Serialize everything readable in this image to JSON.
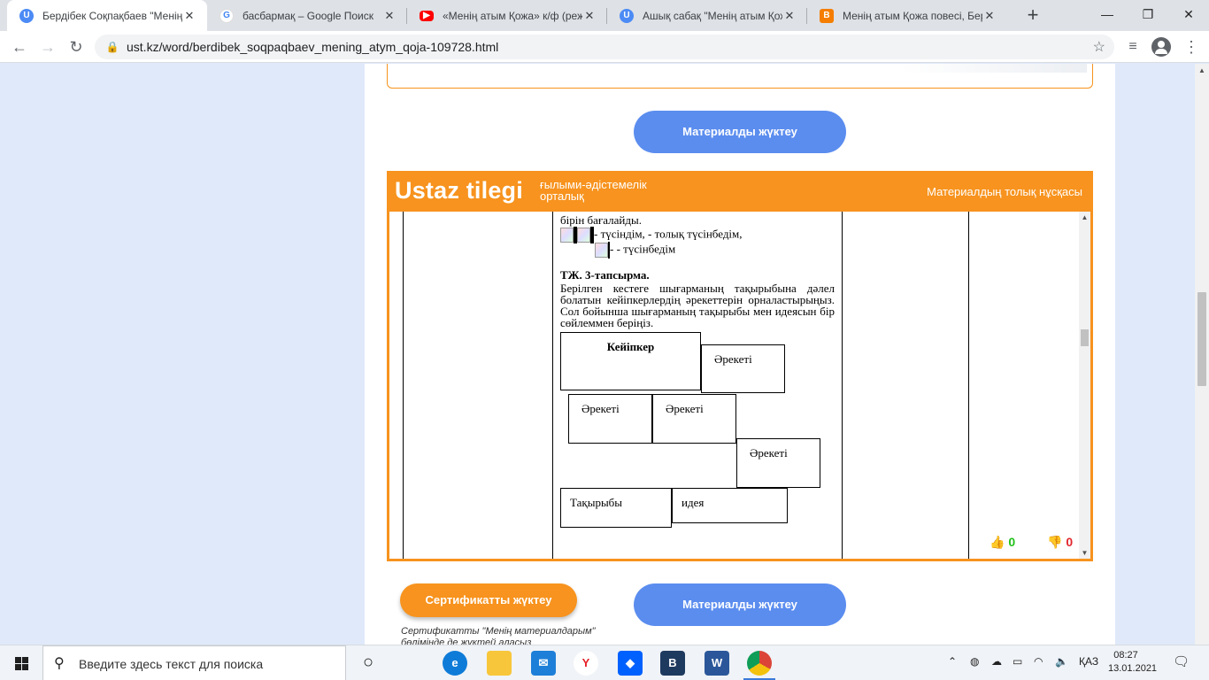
{
  "tabs": [
    {
      "title": "Бердібек Соқпақбаев \"Менің",
      "icon": "ustaz-tilegi-icon",
      "color": "#4c8bf5",
      "active": true
    },
    {
      "title": "басбармақ – Google Поиск",
      "icon": "google-icon",
      "color": "#ffffff",
      "active": false
    },
    {
      "title": "«Менің атым Қожа» к/ф (реж",
      "icon": "youtube-icon",
      "color": "#ff0000",
      "active": false
    },
    {
      "title": "Ашық сабақ \"Менің атым Қож",
      "icon": "ustaz-tilegi-icon",
      "color": "#4c8bf5",
      "active": false
    },
    {
      "title": "Менің атым Қожа повесі, Бер",
      "icon": "blogger-icon",
      "color": "#f57d00",
      "active": false
    }
  ],
  "url": "ust.kz/word/berdibek_soqpaqbaev_mening_atym_qoja-109728.html",
  "buttons": {
    "download_material": "Материалды жүктеу",
    "download_certificate": "Сертификатты жүктеу"
  },
  "viewer": {
    "brand": "Ustaz tilegi",
    "brand_sub": "ғылыми-әдістемелік орталық",
    "full_version": "Материалдың толық нұсқасы"
  },
  "doc": {
    "line1": "бірін бағалайды.",
    "line2": "- түсіндім, - толық түсінбедім,",
    "line3": "- - түсінбедім",
    "task_title": "ТЖ. 3-тапсырма.",
    "task_body": "Берілген кестеге шығарманың тақырыбына дәлел болатын кейіпкерлердің әрекеттерін орналастырыңыз. Сол бойынша шығарманың тақырыбы мен идеясын бір сөйлеммен беріңіз.",
    "box_character": "Кейіпкер",
    "box_action": "Әрекеті",
    "box_theme": "Тақырыбы",
    "box_idea": "идея"
  },
  "likes": {
    "up": "0",
    "down": "0",
    "up_color": "#22c11a",
    "down_color": "#e3262e"
  },
  "cert_note": "Сертификатты \"Менің материалдарым\" бөлімінде де жүктей аласыз",
  "taskbar": {
    "search_placeholder": "Введите здесь текст для поиска",
    "lang": "ҚАЗ",
    "time": "08:27",
    "date": "13.01.2021"
  }
}
